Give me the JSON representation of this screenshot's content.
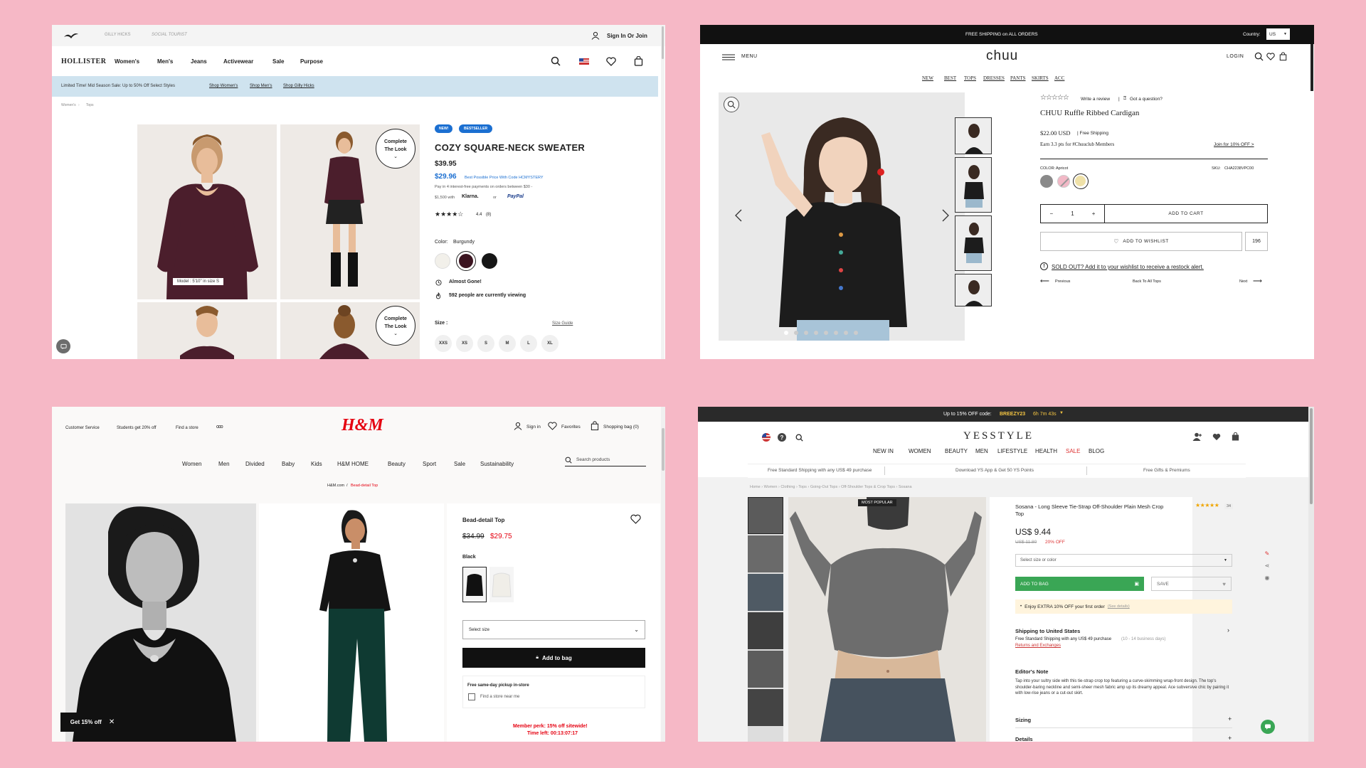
{
  "hollister": {
    "sub_brands": [
      "GILLY HICKS",
      "SOCIAL TOURIST"
    ],
    "sign_in": "Sign In Or Join",
    "logo": "HOLLISTER",
    "nav": [
      "Women's",
      "Men's",
      "Jeans",
      "Activewear",
      "Sale",
      "Purpose"
    ],
    "promo": {
      "text": "Limited Time! Mid Season Sale: Up to 50% Off Select Styles",
      "links": [
        "Shop Women's",
        "Shop Men's",
        "Shop Gilly Hicks"
      ]
    },
    "breadcrumb": [
      "Women's",
      "Tops"
    ],
    "badges": [
      "NEW!",
      "BESTSELLER"
    ],
    "title": "COZY SQUARE-NECK SWEATER",
    "price": "$39.95",
    "sale_price": "$29.96",
    "best_price_note": "Best Possible Price With Code HCMYSTERY",
    "pay_note": "Pay in 4 interest-free payments on orders between $30 -",
    "pay_note2": "$1,500 with",
    "klarna": "Klarna.",
    "or": "or",
    "paypal": "PayPal",
    "rating": "4.4",
    "rating_count": "(8)",
    "color_label": "Color:",
    "color_value": "Burgundy",
    "almost_gone": "Almost Gone!",
    "viewing": "592 people are currently viewing",
    "size_label": "Size :",
    "size_guide": "Size Guide",
    "sizes": [
      "XXS",
      "XS",
      "S",
      "M",
      "L",
      "XL"
    ],
    "model_caption": "Model : 5'10\" in size S",
    "complete_look": "Complete The Look",
    "swatch_colors": [
      "#f2f0ea",
      "#3b1420",
      "#161616"
    ]
  },
  "chuu": {
    "shipping": "FREE SHIPPING on ALL ORDERS",
    "country_label": "Country:",
    "country": "US",
    "menu": "MENU",
    "logo": "chuu",
    "login": "LOGIN",
    "nav": [
      "NEW",
      "BEST",
      "TOPS",
      "DRESSES",
      "PANTS",
      "SKIRTS",
      "ACC"
    ],
    "write_review": "Write a review",
    "question": "Got a question?",
    "title": "CHUU Ruffle Ribbed Cardigan",
    "price": "$22.00 USD",
    "free_shipping": "| Free Shipping",
    "earn": "Earn 3.3 pts for #Chuuclub Members",
    "join": "Join for 10% OFF >",
    "color_label": "COLOR:",
    "color_value": "Apricot",
    "sku_label": "SKU:",
    "sku": "CHA2238VPC00",
    "qty": "1",
    "add_cart": "ADD TO CART",
    "wishlist": "ADD TO WISHLIST",
    "wish_count": "196",
    "soldout": "SOLD OUT? Add it to your wishlist to receive a restock alert.",
    "previous": "Previous",
    "back": "Back To All Tops",
    "next": "Next",
    "swatch_colors": [
      "#8a8a8a",
      "#f2b8c6",
      "#efe1a8"
    ]
  },
  "hm": {
    "top_links": [
      "Customer Service",
      "Students get 20% off",
      "Find a store"
    ],
    "more": "ooo",
    "logo": "H&M",
    "sign_in": "Sign in",
    "favorites": "Favorites",
    "bag": "Shopping bag (0)",
    "nav": [
      "Women",
      "Men",
      "Divided",
      "Baby",
      "Kids",
      "H&M HOME",
      "Beauty",
      "Sport",
      "Sale",
      "Sustainability"
    ],
    "search_placeholder": "Search products",
    "breadcrumb_home": "H&M.com",
    "breadcrumb_sep": "/",
    "breadcrumb_current": "Bead-detail Top",
    "title": "Bead-detail Top",
    "old_price": "$34.99",
    "price": "$29.75",
    "color": "Black",
    "select_size": "Select size",
    "add_bag": "Add to bag",
    "pickup_title": "Free same-day pickup in-store",
    "pickup_store": "Find a store near me",
    "perk": "Member perk: 15% off sitewide!",
    "time_left": "Time left: 00:13:07:17",
    "get_off": "Get 15% off",
    "accent": "#e50010"
  },
  "yesstyle": {
    "promo": "Up to 15% OFF code:",
    "code": "BREEZY23",
    "timer": "6h 7m 43s",
    "logo": "YESSTYLE",
    "nav": [
      "NEW IN",
      "WOMEN",
      "BEAUTY",
      "MEN",
      "LIFESTYLE",
      "HEALTH",
      "SALE",
      "BLOG"
    ],
    "benefits": [
      "Free Standard Shipping with any US$ 49 purchase",
      "Download YS App & Get 50 YS Points",
      "Free Gifts & Premiums"
    ],
    "breadcrumb": [
      "Home",
      "Women",
      "Clothing",
      "Tops",
      "Going-Out Tops",
      "Off-Shoulder Tops & Crop Tops",
      "Sosana"
    ],
    "most_popular": "MOST POPULAR",
    "title": "Sosana - Long Sleeve Tie-Strap Off-Shoulder Plain Mesh Crop Top",
    "review_count": "34",
    "price": "US$ 9.44",
    "old_price": "US$ 11.80",
    "discount": "20% OFF",
    "select": "Select size or color",
    "add_bag": "ADD TO BAG",
    "save": "SAVE",
    "extra": "Enjoy EXTRA 10% OFF your first order",
    "see_details": "(See details)",
    "ship_title": "Shipping to United States",
    "ship_text": "Free Standard Shipping with any US$ 49 purchase",
    "ship_days": "(10 - 14 business days)",
    "returns": "Returns and Exchanges",
    "editor_title": "Editor's Note",
    "editor_text": "Tap into your sultry side with this tie-strap crop top featuring a curve-skimming wrap-front design. The top's shoulder-baring neckline and semi-sheer mesh fabric amp up its dreamy appeal. Ace subversive chic by pairing it with low-rise jeans or a cut-out skirt.",
    "sizing": "Sizing",
    "details": "Details",
    "accent": "#3aa655"
  }
}
